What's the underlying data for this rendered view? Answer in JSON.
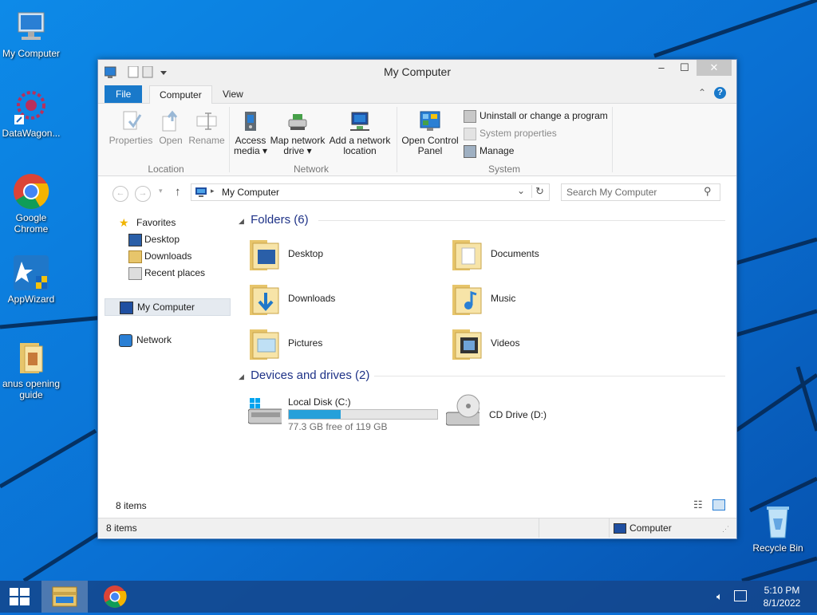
{
  "desktop": {
    "icons": [
      {
        "label": "My Computer",
        "icon": "computer-icon"
      },
      {
        "label": "DataWagon...",
        "icon": "datawagon-icon"
      },
      {
        "label": "Google Chrome",
        "icon": "chrome-icon"
      },
      {
        "label": "AppWizard",
        "icon": "appwizard-icon"
      },
      {
        "label": "anus opening guide",
        "icon": "folder-icon"
      },
      {
        "label": "Recycle Bin",
        "icon": "recycle-bin-icon"
      }
    ]
  },
  "window": {
    "title": "My Computer",
    "controls": {
      "minimize": "–",
      "maximize": "☐",
      "close": "✕"
    },
    "tabs": {
      "file": "File",
      "computer": "Computer",
      "view": "View"
    },
    "ribbon": {
      "location": {
        "label": "Location",
        "properties": "Properties",
        "open": "Open",
        "rename": "Rename"
      },
      "network": {
        "label": "Network",
        "access_media": [
          "Access",
          "media ▾"
        ],
        "map_drive": [
          "Map network",
          "drive ▾"
        ],
        "add_location": [
          "Add a network",
          "location"
        ]
      },
      "system": {
        "label": "System",
        "open_control_panel": [
          "Open Control",
          "Panel"
        ],
        "uninstall": "Uninstall or change a program",
        "system_properties": "System properties",
        "manage": "Manage"
      }
    },
    "address": {
      "path": "My Computer",
      "search_placeholder": "Search My Computer"
    },
    "nav": {
      "favorites": "Favorites",
      "desktop": "Desktop",
      "downloads": "Downloads",
      "recent": "Recent places",
      "my_computer": "My Computer",
      "network": "Network"
    },
    "content": {
      "folders_header": "Folders (6)",
      "folders": [
        {
          "name": "Desktop",
          "icon": "desktop-folder-icon"
        },
        {
          "name": "Documents",
          "icon": "documents-folder-icon"
        },
        {
          "name": "Downloads",
          "icon": "downloads-folder-icon"
        },
        {
          "name": "Music",
          "icon": "music-folder-icon"
        },
        {
          "name": "Pictures",
          "icon": "pictures-folder-icon"
        },
        {
          "name": "Videos",
          "icon": "videos-folder-icon"
        }
      ],
      "devices_header": "Devices and drives (2)",
      "drives": [
        {
          "name": "Local Disk (C:)",
          "free": "77.3 GB free of 119 GB",
          "used_fraction": 0.35
        },
        {
          "name": "CD Drive (D:)"
        }
      ]
    },
    "status": {
      "items_inner": "8 items",
      "items": "8 items",
      "location": "Computer"
    }
  },
  "taskbar": {
    "time": "5:10 PM",
    "date": "8/1/2022"
  },
  "colors": {
    "accent": "#1979ca",
    "section_header": "#1e3287",
    "drive_bar": "#26a0da"
  }
}
